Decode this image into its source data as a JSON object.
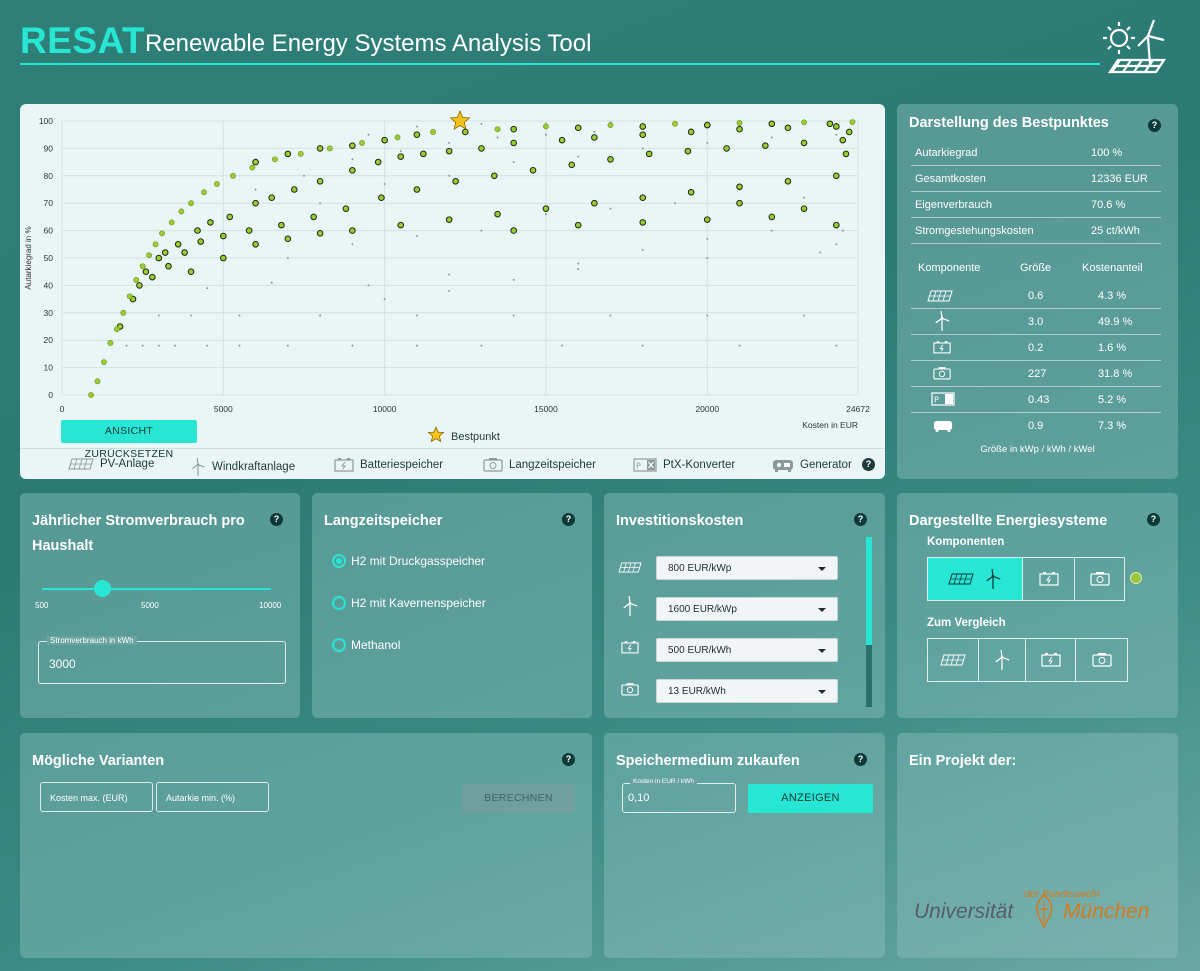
{
  "header": {
    "brand": "RESAT",
    "subtitle": "Renewable Energy Systems Analysis Tool",
    "logo_icon": "sun-wind-solar-logo-icon"
  },
  "chart": {
    "reset_label": "ANSICHT ZURÜCKSETZEN",
    "best_label": "Bestpunkt",
    "legend": [
      {
        "icon": "pv-panel-icon",
        "label": "PV-Anlage"
      },
      {
        "icon": "wind-turbine-icon",
        "label": "Windkraftanlage"
      },
      {
        "icon": "battery-icon",
        "label": "Batteriespeicher"
      },
      {
        "icon": "long-term-storage-icon",
        "label": "Langzeitspeicher"
      },
      {
        "icon": "ptx-converter-icon",
        "label": "PtX-Konverter"
      },
      {
        "icon": "generator-icon",
        "label": "Generator"
      }
    ]
  },
  "chart_data": {
    "type": "scatter",
    "ylabel": "Autarkiegrad in %",
    "xlabel": "Kosten in EUR",
    "xlim": [
      0,
      24672
    ],
    "ylim": [
      0,
      100
    ],
    "x_ticks": [
      "0",
      "5000",
      "10000",
      "15000",
      "20000",
      "24672"
    ],
    "y_ticks": [
      "0",
      "10",
      "20",
      "30",
      "40",
      "50",
      "60",
      "70",
      "80",
      "90",
      "100"
    ],
    "grid": true,
    "best_point": {
      "x": 12336,
      "y": 100
    },
    "series": [
      {
        "color": "#9acd32",
        "values_desc": "pareto front",
        "points": [
          [
            900,
            0
          ],
          [
            1100,
            5
          ],
          [
            1300,
            12
          ],
          [
            1500,
            19
          ],
          [
            1700,
            24
          ],
          [
            1900,
            30
          ],
          [
            2100,
            36
          ],
          [
            2300,
            42
          ],
          [
            2500,
            47
          ],
          [
            2700,
            51
          ],
          [
            2900,
            55
          ],
          [
            3100,
            59
          ],
          [
            3400,
            63
          ],
          [
            3700,
            67
          ],
          [
            4000,
            70
          ],
          [
            4400,
            74
          ],
          [
            4800,
            77
          ],
          [
            5300,
            80
          ],
          [
            5900,
            83
          ],
          [
            6600,
            86
          ],
          [
            7400,
            88
          ],
          [
            8300,
            90
          ],
          [
            9300,
            92
          ],
          [
            10400,
            94
          ],
          [
            11500,
            96
          ],
          [
            12336,
            100
          ],
          [
            13500,
            97
          ],
          [
            15000,
            98
          ],
          [
            17000,
            98.5
          ],
          [
            19000,
            99
          ],
          [
            21000,
            99.3
          ],
          [
            23000,
            99.5
          ],
          [
            24500,
            99.6
          ]
        ]
      },
      {
        "color": "#6e9b1e",
        "values_desc": "evaluated systems",
        "points": [
          [
            1800,
            25
          ],
          [
            2200,
            35
          ],
          [
            2600,
            45
          ],
          [
            3000,
            50
          ],
          [
            3200,
            52
          ],
          [
            3600,
            55
          ],
          [
            4200,
            60
          ],
          [
            4600,
            63
          ],
          [
            5200,
            65
          ],
          [
            6000,
            70
          ],
          [
            6500,
            72
          ],
          [
            7200,
            75
          ],
          [
            8000,
            78
          ],
          [
            9000,
            82
          ],
          [
            9800,
            85
          ],
          [
            10500,
            87
          ],
          [
            11200,
            88
          ],
          [
            12000,
            89
          ],
          [
            13000,
            90
          ],
          [
            14000,
            92
          ],
          [
            15500,
            93
          ],
          [
            16500,
            94
          ],
          [
            18000,
            95
          ],
          [
            19500,
            96
          ],
          [
            21000,
            97
          ],
          [
            22500,
            97.5
          ],
          [
            24000,
            98
          ],
          [
            2400,
            40
          ],
          [
            2800,
            43
          ],
          [
            3300,
            47
          ],
          [
            3800,
            52
          ],
          [
            4300,
            56
          ],
          [
            5000,
            58
          ],
          [
            5800,
            60
          ],
          [
            6800,
            62
          ],
          [
            7800,
            65
          ],
          [
            8800,
            68
          ],
          [
            9900,
            72
          ],
          [
            11000,
            75
          ],
          [
            12200,
            78
          ],
          [
            13400,
            80
          ],
          [
            14600,
            82
          ],
          [
            15800,
            84
          ],
          [
            17000,
            86
          ],
          [
            18200,
            88
          ],
          [
            19400,
            89
          ],
          [
            20600,
            90
          ],
          [
            21800,
            91
          ],
          [
            23000,
            92
          ],
          [
            24200,
            93
          ],
          [
            4000,
            45
          ],
          [
            5000,
            50
          ],
          [
            6000,
            55
          ],
          [
            7000,
            57
          ],
          [
            8000,
            59
          ],
          [
            9000,
            60
          ],
          [
            10500,
            62
          ],
          [
            12000,
            64
          ],
          [
            13500,
            66
          ],
          [
            15000,
            68
          ],
          [
            16500,
            70
          ],
          [
            18000,
            72
          ],
          [
            19500,
            74
          ],
          [
            21000,
            76
          ],
          [
            22500,
            78
          ],
          [
            24000,
            80
          ],
          [
            14000,
            60
          ],
          [
            16000,
            62
          ],
          [
            18000,
            63
          ],
          [
            20000,
            64
          ],
          [
            22000,
            65
          ],
          [
            24000,
            62
          ],
          [
            21000,
            70
          ],
          [
            23000,
            68
          ],
          [
            24300,
            88
          ],
          [
            24400,
            96
          ],
          [
            6000,
            85
          ],
          [
            7000,
            88
          ],
          [
            8000,
            90
          ],
          [
            9000,
            91
          ],
          [
            10000,
            93
          ],
          [
            11000,
            95
          ],
          [
            12500,
            96
          ],
          [
            14000,
            97
          ],
          [
            16000,
            97.5
          ],
          [
            18000,
            98
          ],
          [
            20000,
            98.5
          ],
          [
            22000,
            99
          ],
          [
            23800,
            99
          ]
        ]
      },
      {
        "color": "#8a9a9a",
        "values_desc": "other combinations",
        "points": [
          [
            2000,
            18
          ],
          [
            2500,
            18
          ],
          [
            3000,
            18
          ],
          [
            3500,
            18
          ],
          [
            4500,
            18
          ],
          [
            5500,
            18
          ],
          [
            7000,
            18
          ],
          [
            9000,
            18
          ],
          [
            11000,
            18
          ],
          [
            13000,
            18
          ],
          [
            15500,
            18
          ],
          [
            18000,
            18
          ],
          [
            21000,
            18
          ],
          [
            24000,
            18
          ],
          [
            3000,
            29
          ],
          [
            4000,
            29
          ],
          [
            5500,
            29
          ],
          [
            8000,
            29
          ],
          [
            11000,
            29
          ],
          [
            14000,
            29
          ],
          [
            17000,
            29
          ],
          [
            20000,
            29
          ],
          [
            23000,
            29
          ],
          [
            4500,
            39
          ],
          [
            6500,
            41
          ],
          [
            9500,
            40
          ],
          [
            12000,
            44
          ],
          [
            16000,
            46
          ],
          [
            20000,
            50
          ],
          [
            23500,
            52
          ],
          [
            7000,
            50
          ],
          [
            9000,
            55
          ],
          [
            11000,
            58
          ],
          [
            13000,
            60
          ],
          [
            15000,
            66
          ],
          [
            17000,
            68
          ],
          [
            19000,
            70
          ],
          [
            21000,
            75
          ],
          [
            23000,
            72
          ],
          [
            24200,
            60
          ],
          [
            8000,
            70
          ],
          [
            10000,
            77
          ],
          [
            12000,
            80
          ],
          [
            14000,
            85
          ],
          [
            16000,
            87
          ],
          [
            18000,
            90
          ],
          [
            20000,
            92
          ],
          [
            22000,
            94
          ],
          [
            24000,
            95
          ],
          [
            9500,
            95
          ],
          [
            11000,
            98
          ],
          [
            13000,
            99
          ],
          [
            15000,
            99
          ],
          [
            17000,
            99.5
          ],
          [
            19000,
            99.5
          ],
          [
            21000,
            99.8
          ],
          [
            23000,
            99.8
          ],
          [
            6000,
            75
          ],
          [
            7500,
            80
          ],
          [
            9000,
            86
          ],
          [
            10500,
            89
          ],
          [
            12000,
            92
          ],
          [
            13500,
            94
          ],
          [
            15000,
            95
          ],
          [
            16500,
            96
          ],
          [
            18000,
            97
          ],
          [
            19500,
            97
          ],
          [
            21000,
            98
          ],
          [
            22500,
            98
          ],
          [
            24000,
            99
          ],
          [
            10000,
            35
          ],
          [
            12000,
            38
          ],
          [
            14000,
            42
          ],
          [
            16000,
            48
          ],
          [
            18000,
            53
          ],
          [
            20000,
            57
          ],
          [
            22000,
            60
          ],
          [
            24000,
            55
          ]
        ]
      }
    ]
  },
  "best": {
    "title": "Darstellung des Bestpunktes",
    "rows": [
      {
        "label": "Autarkiegrad",
        "value": "100 %"
      },
      {
        "label": "Gesamtkosten",
        "value": "12336 EUR"
      },
      {
        "label": "Eigenverbrauch",
        "value": "70.6 %"
      },
      {
        "label": "Stromgestehungskosten",
        "value": "25 ct/kWh"
      }
    ],
    "head_comp": "Komponente",
    "head_size": "Größe",
    "head_share": "Kostenanteil",
    "components": [
      {
        "icon": "pv-panel-icon",
        "size": "0.6",
        "share": "4.3 %"
      },
      {
        "icon": "wind-turbine-icon",
        "size": "3.0",
        "share": "49.9 %"
      },
      {
        "icon": "battery-icon",
        "size": "0.2",
        "share": "1.6 %"
      },
      {
        "icon": "long-term-storage-icon",
        "size": "227",
        "share": "31.8 %"
      },
      {
        "icon": "ptx-converter-icon",
        "size": "0.43",
        "share": "5.2 %"
      },
      {
        "icon": "generator-icon",
        "size": "0.9",
        "share": "7.3 %"
      }
    ],
    "units": "Größe in kWp / kWh / kWel"
  },
  "consumption": {
    "title": "Jährlicher Stromverbrauch pro Haushalt",
    "slider_min": "500",
    "slider_mid": "5000",
    "slider_max": "10000",
    "slider_value": 3000,
    "field_label": "Stromverbrauch in kWh",
    "field_value": "3000"
  },
  "longterm": {
    "title": "Langzeitspeicher",
    "options": [
      {
        "label": "H2 mit Druckgasspeicher",
        "selected": true
      },
      {
        "label": "H2 mit Kavernenspeicher",
        "selected": false
      },
      {
        "label": "Methanol",
        "selected": false
      }
    ]
  },
  "investment": {
    "title": "Investitionskosten",
    "items": [
      {
        "icon": "pv-panel-icon",
        "value": "800 EUR/kWp"
      },
      {
        "icon": "wind-turbine-icon",
        "value": "1600 EUR/kWp"
      },
      {
        "icon": "battery-icon",
        "value": "500 EUR/kWh"
      },
      {
        "icon": "long-term-storage-icon",
        "value": "13 EUR/kWh"
      }
    ]
  },
  "systems": {
    "title": "Dargestellte Energiesysteme",
    "components_label": "Komponenten",
    "compare_label": "Zum Vergleich",
    "indicator_color": "#9dc63d"
  },
  "variants": {
    "title": "Mögliche Varianten",
    "cost_placeholder": "Kosten max. (EUR)",
    "autarky_placeholder": "Autarkie min. (%)",
    "calc_label": "BERECHNEN"
  },
  "storage": {
    "title": "Speichermedium zukaufen",
    "field_label": "Kosten in EUR / kWh",
    "field_value": "0,10",
    "button_label": "ANZEIGEN"
  },
  "project": {
    "title": "Ein Projekt der:",
    "uni_left": "Universität",
    "uni_right": "München",
    "uni_top": "der Bundeswehr"
  },
  "colors": {
    "accent": "#28e6d4",
    "front": "#9acd32"
  }
}
